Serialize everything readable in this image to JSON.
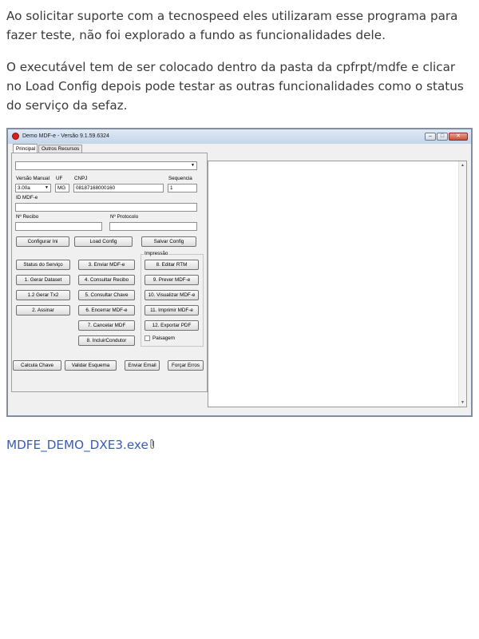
{
  "post": {
    "paragraph1": "Ao solicitar suporte com a tecnospeed eles utilizaram esse programa para fazer teste, não foi explorado a fundo as funcionalidades dele.",
    "paragraph2": "O executável tem de ser colocado dentro da pasta da cpfrpt/mdfe e clicar no Load Config depois pode testar as outras funcionalidades como o status do serviço da sefaz.",
    "attachment_label": "MDFE_DEMO_DXE3.exe",
    "link_color": "#3b5bb5"
  },
  "app": {
    "window_title": "Demo MDF-e - Versão 9.1.59.6324",
    "window_controls": {
      "minimize": "–",
      "maximize": "□",
      "close": "✕"
    },
    "tabs": [
      "Principal",
      "Outros Recursos"
    ],
    "top_select_value": "",
    "fields": {
      "versao_manual_label": "Versão Manual",
      "versao_manual_value": "3.00a",
      "uf_label": "UF",
      "uf_value": "MG",
      "cnpj_label": "CNPJ",
      "cnpj_value": "08187168000160",
      "sequencia_label": "Sequencia",
      "sequencia_value": "1",
      "id_mdfe_label": "ID MDF-e",
      "id_mdfe_value": "",
      "recibo_label": "Nº Recibo",
      "recibo_value": "",
      "protocolo_label": "Nº Protocolo",
      "protocolo_value": ""
    },
    "config_buttons": [
      "Configurar Ini",
      "Load Config",
      "Salvar Config"
    ],
    "actions_left": [
      "Status do Serviço",
      "1. Gerar Dataset",
      "1.2 Gerar Tx2",
      "2. Assinar"
    ],
    "actions_middle": [
      "3. Enviar MDF-e",
      "4. Consultar Recibo",
      "5. Consultar Chave",
      "6. Encerrar MDF-e",
      "7. Cancelar MDF",
      "8. IncluirCondutor"
    ],
    "impressao": {
      "title": "Impressão",
      "buttons": [
        "8. Editar RTM",
        "9. Prever MDF-e",
        "10. Visualizar MDF-e",
        "11. Imprimir MDF-e",
        "12. Exportar PDF"
      ],
      "checkbox_label": "Paisagem"
    },
    "bottom_buttons": [
      "Calcula Chave",
      "Validar Esquema",
      "Enviar Email",
      "Forçar Erros"
    ],
    "scroll_up": "▲",
    "scroll_down": "▼"
  }
}
